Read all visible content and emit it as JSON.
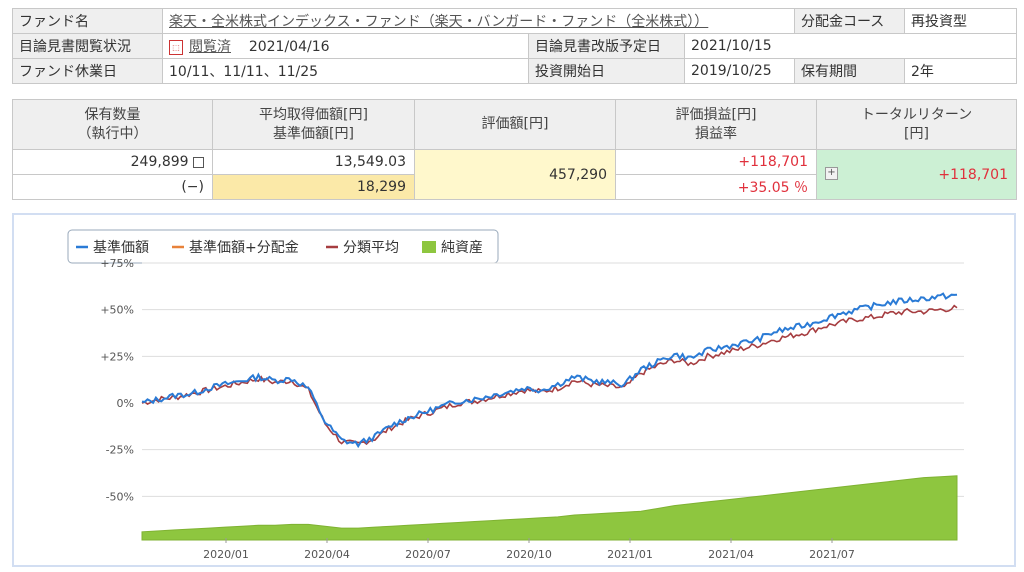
{
  "info": {
    "fund_name_label": "ファンド名",
    "fund_name": "楽天・全米株式インデックス・ファンド（楽天・バンガード・ファンド（全米株式））",
    "dist_course_label": "分配金コース",
    "dist_course": "再投資型",
    "prospectus_status_label": "目論見書閲覧状況",
    "prospectus_status": "閲覧済",
    "prospectus_date": "2021/04/16",
    "revision_label": "目論見書改版予定日",
    "revision_date": "2021/10/15",
    "holiday_label": "ファンド休業日",
    "holiday_value": "10/11、11/11、11/25",
    "start_label": "投資開始日",
    "start_date": "2019/10/25",
    "period_label": "保有期間",
    "period_value": "2年"
  },
  "holdings": {
    "headers": {
      "qty": "保有数量\n（執行中）",
      "avg": "平均取得価額[円]\n基準価額[円]",
      "value": "評価額[円]",
      "pl": "評価損益[円]\n損益率",
      "total": "トータルリターン\n[円]"
    },
    "qty": "249,899",
    "qty_pending": "(−)",
    "avg_cost": "13,549.03",
    "nav": "18,299",
    "value": "457,290",
    "pl": "+118,701",
    "pl_rate": "+35.05 ％",
    "total_return": "+118,701"
  },
  "chart_data": {
    "type": "line",
    "legend": [
      "基準価額",
      "基準価額+分配金",
      "分類平均",
      "純資産"
    ],
    "colors": {
      "nav": "#2a7bd6",
      "nav_dist": "#e8823a",
      "category_avg": "#a63d40",
      "net_assets": "#8ec63f"
    },
    "y_ticks": [
      "+75%",
      "+50%",
      "+25%",
      "0%",
      "-25%",
      "-50%"
    ],
    "y_values": [
      75,
      50,
      25,
      0,
      -25,
      -50
    ],
    "ylim": [
      -75,
      75
    ],
    "x_ticks": [
      "2020/01",
      "2020/04",
      "2020/07",
      "2020/10",
      "2021/01",
      "2021/04",
      "2021/07"
    ],
    "x_range": [
      "2019-10",
      "2021-10"
    ],
    "nav_series": [
      0,
      2,
      4,
      5,
      8,
      10,
      12,
      14,
      12,
      13,
      8,
      -10,
      -20,
      -22,
      -18,
      -12,
      -8,
      -5,
      -2,
      1,
      2,
      4,
      6,
      8,
      7,
      10,
      14,
      12,
      11,
      10,
      18,
      22,
      26,
      24,
      28,
      30,
      32,
      34,
      38,
      40,
      42,
      45,
      48,
      50,
      52,
      54,
      55,
      56,
      57,
      58
    ],
    "category_avg_series": [
      0,
      2,
      3,
      5,
      7,
      9,
      11,
      13,
      11,
      12,
      7,
      -11,
      -21,
      -22,
      -19,
      -13,
      -9,
      -6,
      -3,
      0,
      1,
      3,
      5,
      7,
      6,
      8,
      12,
      10,
      9,
      8,
      16,
      20,
      23,
      21,
      25,
      27,
      29,
      31,
      34,
      36,
      38,
      41,
      43,
      45,
      46,
      48,
      49,
      49,
      50,
      51
    ],
    "net_assets_series": [
      -69,
      -68.5,
      -68,
      -67.5,
      -67,
      -66.5,
      -66,
      -65.5,
      -65.5,
      -65,
      -65,
      -66,
      -67,
      -67,
      -66.5,
      -66,
      -65.5,
      -65,
      -64.5,
      -64,
      -63.5,
      -63,
      -62.5,
      -62,
      -61.5,
      -61,
      -60,
      -59.5,
      -59,
      -58.5,
      -58,
      -56.5,
      -55,
      -54,
      -53,
      -52,
      -51,
      -50,
      -49,
      -48,
      -47,
      -46,
      -45,
      -44,
      -43,
      -42,
      -41,
      -40,
      -39.5,
      -39
    ]
  }
}
